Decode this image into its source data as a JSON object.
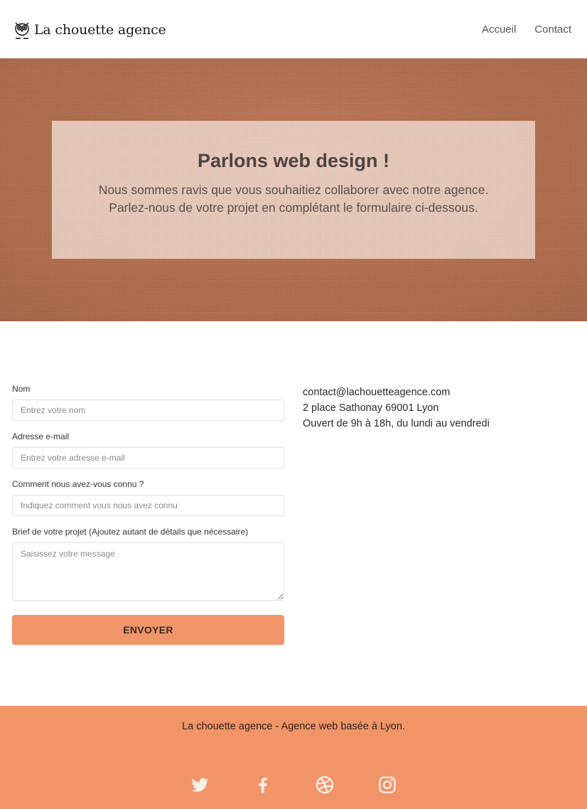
{
  "header": {
    "brand_name": "La chouette agence",
    "nav": {
      "home": "Accueil",
      "contact": "Contact"
    }
  },
  "hero": {
    "title": "Parlons web design !",
    "line1": "Nous sommes ravis que vous souhaitiez collaborer avec notre agence.",
    "line2": "Parlez-nous de votre projet en complétant le formulaire ci-dessous."
  },
  "form": {
    "name_label": "Nom",
    "name_placeholder": "Entrez votre nom",
    "email_label": "Adresse e-mail",
    "email_placeholder": "Entrez votre adresse e-mail",
    "source_label": "Comment nous avez-vous connu ?",
    "source_placeholder": "Indiquez comment vous nous avez connu",
    "brief_label": "Brief de votre projet (Ajoutez autant de détails que nécessaire)",
    "brief_placeholder": "Saisissez votre message",
    "submit": "ENVOYER"
  },
  "info": {
    "email": "contact@lachouetteagence.com",
    "address": "2 place Sathonay 69001 Lyon",
    "hours": "Ouvert de 9h à 18h, du lundi au vendredi"
  },
  "footer": {
    "text": "La chouette agence - Agence web basée à Lyon.",
    "socials": [
      "twitter-icon",
      "facebook-icon",
      "dribbble-icon",
      "instagram-icon"
    ]
  },
  "colors": {
    "accent": "#f19468",
    "hero_bg": "#b8704e",
    "hero_box": "#ebd4c8"
  }
}
